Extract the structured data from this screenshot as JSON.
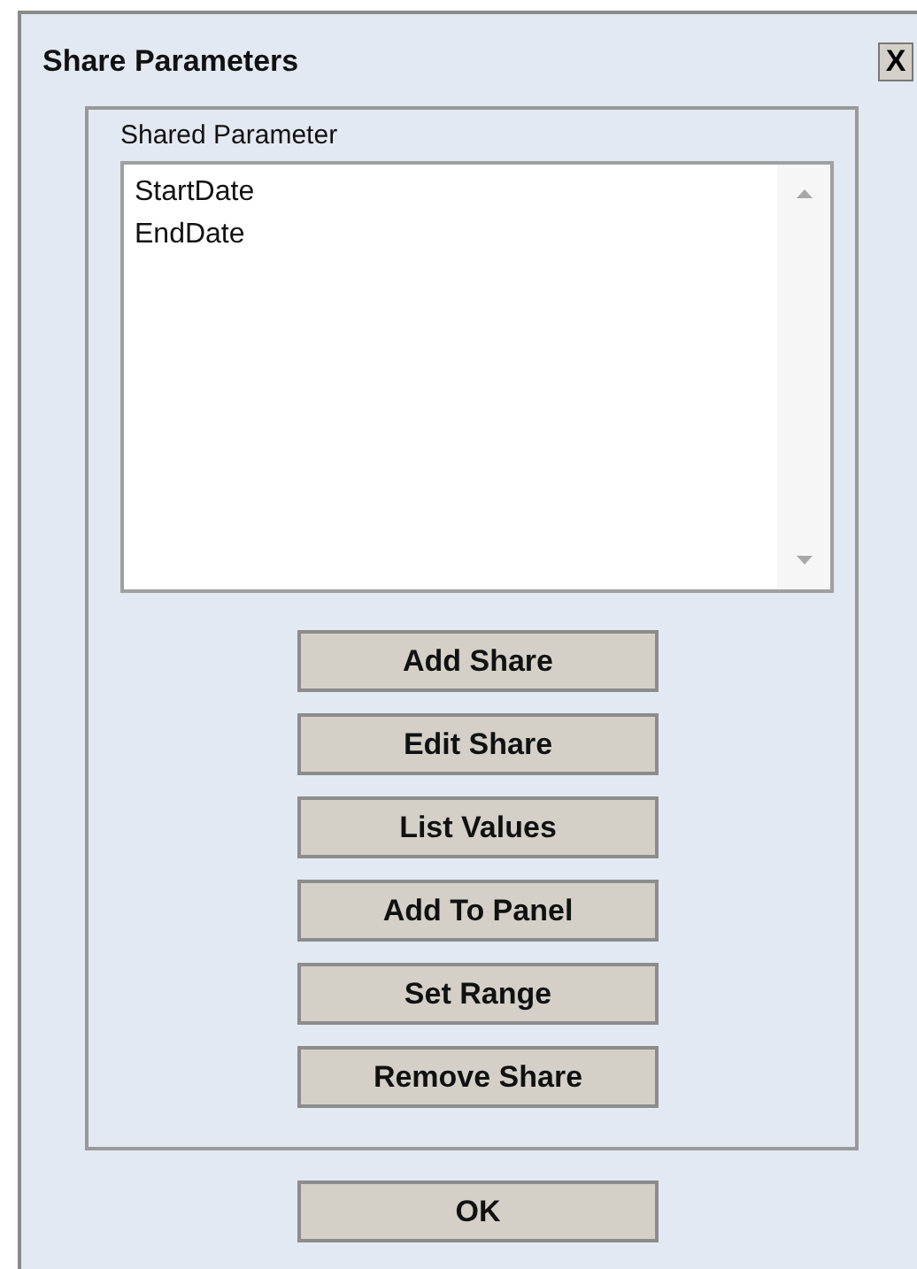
{
  "window": {
    "title": "Share Parameters",
    "close_label": "X"
  },
  "group": {
    "label": "Shared Parameter",
    "items": [
      {
        "label": "StartDate",
        "selected": false
      },
      {
        "label": "EndDate",
        "selected": false
      }
    ],
    "buttons": [
      "Add Share",
      "Edit Share",
      "List Values",
      "Add To Panel",
      "Set Range",
      "Remove Share"
    ]
  },
  "footer_buttons": [
    "OK"
  ]
}
